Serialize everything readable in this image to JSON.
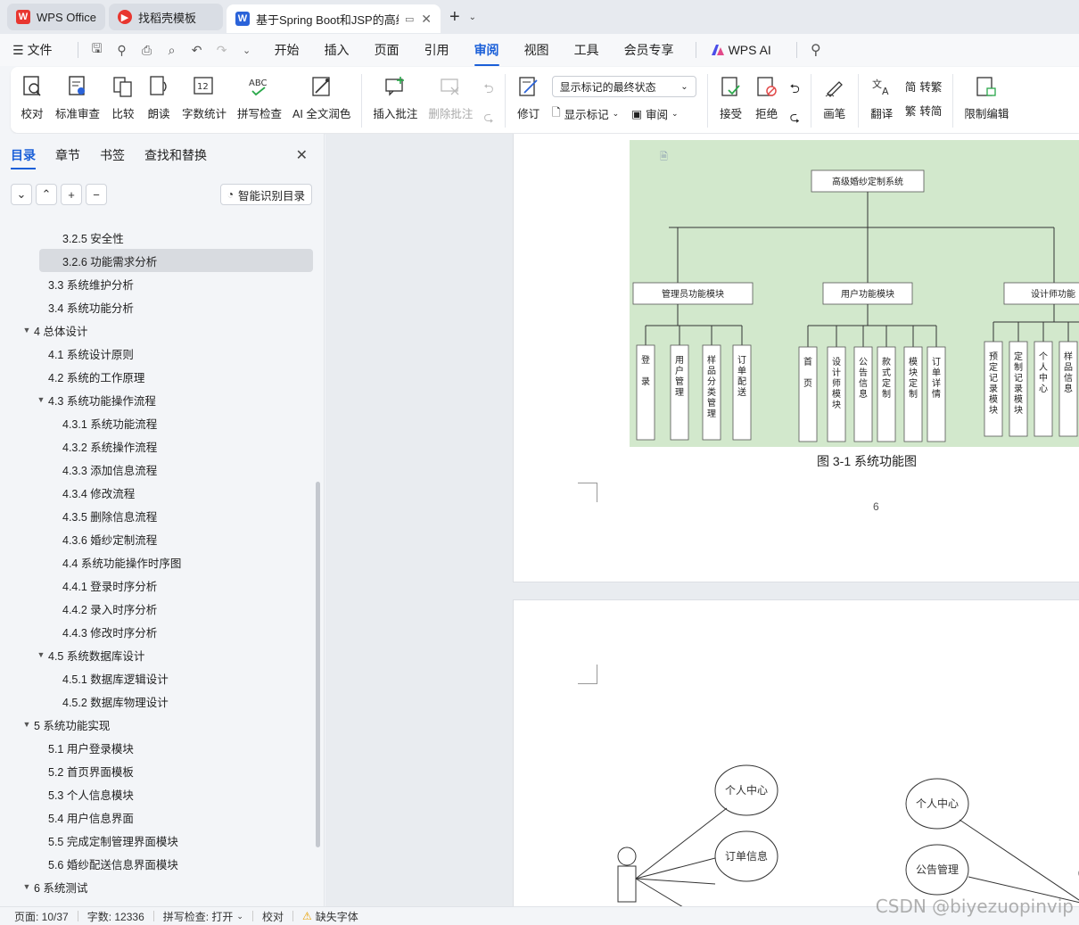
{
  "tabs": [
    {
      "label": "WPS Office",
      "logo": "W",
      "color": "#e8362f"
    },
    {
      "label": "找稻壳模板",
      "logo": "稻",
      "color": "#e8362f"
    },
    {
      "label": "基于Spring Boot和JSP的高级",
      "logo": "W",
      "color": "#2b63d9"
    }
  ],
  "menu": {
    "file_label": "文件",
    "tabs": [
      "开始",
      "插入",
      "页面",
      "引用",
      "审阅",
      "视图",
      "工具",
      "会员专享"
    ],
    "active_tab": "审阅",
    "wps_ai": "WPS AI"
  },
  "ribbon": {
    "proofread": "校对",
    "std_review": "标准审查",
    "compare": "比较",
    "read_aloud": "朗读",
    "word_count": "字数统计",
    "spell_check": "拼写检查",
    "ai_polish": "AI 全文润色",
    "insert_comment": "插入批注",
    "delete_comment": "删除批注",
    "revise": "修订",
    "display_state": "显示标记的最终状态",
    "show_markup": "显示标记",
    "review": "审阅",
    "accept": "接受",
    "reject": "拒绝",
    "pen": "画笔",
    "translate": "翻译",
    "to_traditional": "转繁",
    "to_simplified": "转简",
    "restrict_edit": "限制编辑"
  },
  "nav": {
    "tabs": [
      "目录",
      "章节",
      "书签",
      "查找和替换"
    ],
    "smart_btn": "智能识别目录",
    "toc": [
      {
        "text": "3.2.5  安全性",
        "level": 3
      },
      {
        "text": "3.2.6  功能需求分析",
        "level": 3,
        "selected": true
      },
      {
        "text": "3.3  系统维护分析",
        "level": 2
      },
      {
        "text": "3.4  系统功能分析",
        "level": 2
      },
      {
        "text": "4  总体设计",
        "level": 1,
        "expanded": true
      },
      {
        "text": "4.1 系统设计原则",
        "level": 2
      },
      {
        "text": "4.2 系统的工作原理",
        "level": 2
      },
      {
        "text": "4.3 系统功能操作流程",
        "level": 2,
        "expanded": true
      },
      {
        "text": "4.3.1 系统功能流程",
        "level": 3
      },
      {
        "text": "4.3.2 系统操作流程",
        "level": 3
      },
      {
        "text": "4.3.3 添加信息流程",
        "level": 3
      },
      {
        "text": "4.3.4 修改流程",
        "level": 3
      },
      {
        "text": "4.3.5 删除信息流程",
        "level": 3
      },
      {
        "text": "4.3.6 婚纱定制流程",
        "level": 3
      },
      {
        "text": "4.4 系统功能操作时序图",
        "level": 3
      },
      {
        "text": "4.4.1 登录时序分析",
        "level": 3
      },
      {
        "text": "4.4.2 录入时序分析",
        "level": 3
      },
      {
        "text": "4.4.3 修改时序分析",
        "level": 3
      },
      {
        "text": "4.5 系统数据库设计",
        "level": 2,
        "expanded": true
      },
      {
        "text": "4.5.1 数据库逻辑设计",
        "level": 3
      },
      {
        "text": "4.5.2 数据库物理设计",
        "level": 3
      },
      {
        "text": "5  系统功能实现",
        "level": 1,
        "expanded": true
      },
      {
        "text": "5.1  用户登录模块",
        "level": 2
      },
      {
        "text": "5.2  首页界面模板",
        "level": 2
      },
      {
        "text": "5.3  个人信息模块",
        "level": 2
      },
      {
        "text": "5.4  用户信息界面",
        "level": 2
      },
      {
        "text": "5.5  完成定制管理界面模块",
        "level": 2
      },
      {
        "text": "5.6  婚纱配送信息界面模块",
        "level": 2
      },
      {
        "text": "6 系统测试",
        "level": 1,
        "expanded": true
      }
    ]
  },
  "doc": {
    "diagram": {
      "root": "高级婚纱定制系统",
      "modules": [
        "管理员功能模块",
        "用户功能模块",
        "设计师功能"
      ],
      "admin_leaves": [
        "登\n\n录",
        "用户管理",
        "样品分类管理",
        "订单配送"
      ],
      "user_leaves": [
        "首\n\n页",
        "设计师模块",
        "公告信息",
        "款式定制",
        "模块定制",
        "订单详情"
      ],
      "designer_leaves": [
        "预定记录模块",
        "定制记录模块",
        "个人中心",
        "样品信息"
      ]
    },
    "caption": "图 3-1  系统功能图",
    "page_number": "6",
    "usecase_left": [
      "个人中心",
      "订单信息"
    ],
    "usecase_right": [
      "个人中心",
      "公告管理"
    ]
  },
  "status": {
    "page": "页面: 10/37",
    "words": "字数: 12336",
    "spell": "拼写检查: 打开",
    "proof": "校对",
    "missing_font": "缺失字体"
  },
  "watermark": "CSDN @biyezuopinvip"
}
